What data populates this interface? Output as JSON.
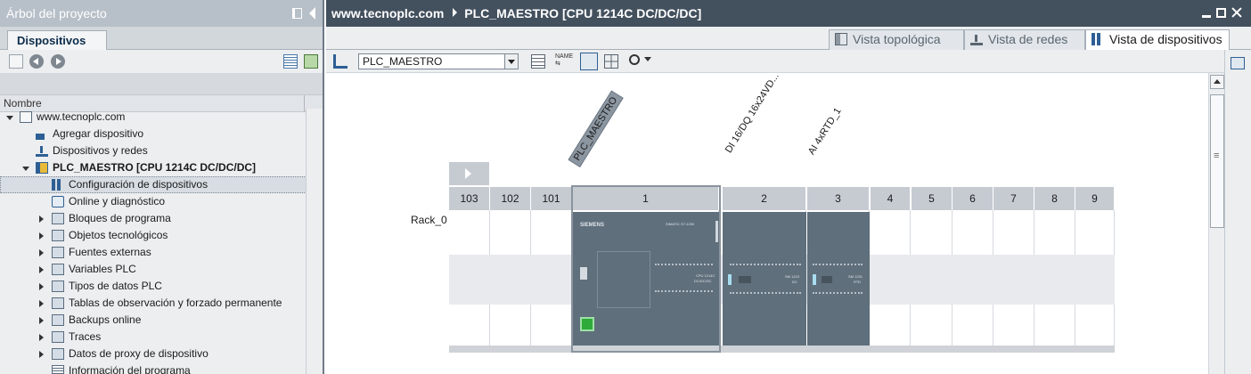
{
  "left": {
    "title": "Árbol del proyecto",
    "tab": "Dispositivos",
    "column_header": "Nombre",
    "tree": [
      {
        "label": "www.tecnoplc.com",
        "level": 0,
        "twisty": "open",
        "icon": "project-icon"
      },
      {
        "label": "Agregar dispositivo",
        "level": 1,
        "twisty": "none",
        "icon": "add-device-icon"
      },
      {
        "label": "Dispositivos y redes",
        "level": 1,
        "twisty": "none",
        "icon": "network-icon"
      },
      {
        "label": "PLC_MAESTRO [CPU 1214C DC/DC/DC]",
        "level": 1,
        "twisty": "open",
        "icon": "plc-icon",
        "bold": true
      },
      {
        "label": "Configuración de dispositivos",
        "level": 2,
        "twisty": "none",
        "icon": "device-config-icon",
        "selected": true
      },
      {
        "label": "Online y diagnóstico",
        "level": 2,
        "twisty": "none",
        "icon": "online-diagnostics-icon"
      },
      {
        "label": "Bloques de programa",
        "level": 2,
        "twisty": "closed",
        "icon": "folder-icon"
      },
      {
        "label": "Objetos tecnológicos",
        "level": 2,
        "twisty": "closed",
        "icon": "folder-icon"
      },
      {
        "label": "Fuentes externas",
        "level": 2,
        "twisty": "closed",
        "icon": "folder-icon"
      },
      {
        "label": "Variables PLC",
        "level": 2,
        "twisty": "closed",
        "icon": "folder-icon"
      },
      {
        "label": "Tipos de datos PLC",
        "level": 2,
        "twisty": "closed",
        "icon": "folder-icon"
      },
      {
        "label": "Tablas de observación y forzado permanente",
        "level": 2,
        "twisty": "closed",
        "icon": "folder-icon"
      },
      {
        "label": "Backups online",
        "level": 2,
        "twisty": "closed",
        "icon": "folder-icon"
      },
      {
        "label": "Traces",
        "level": 2,
        "twisty": "closed",
        "icon": "folder-icon"
      },
      {
        "label": "Datos de proxy de dispositivo",
        "level": 2,
        "twisty": "closed",
        "icon": "folder-icon"
      },
      {
        "label": "Información del programa",
        "level": 2,
        "twisty": "none",
        "icon": "program-info-icon"
      }
    ]
  },
  "right": {
    "breadcrumb_root": "www.tecnoplc.com",
    "breadcrumb_device": "PLC_MAESTRO [CPU 1214C DC/DC/DC]",
    "tabs": [
      {
        "label": "Vista topológica",
        "icon": "topology-icon",
        "active": false
      },
      {
        "label": "Vista de redes",
        "icon": "network-icon",
        "active": false
      },
      {
        "label": "Vista de dispositivos",
        "icon": "device-view-icon",
        "active": true
      }
    ],
    "device_select": "PLC_MAESTRO",
    "rack_label": "Rack_0",
    "slots": [
      "103",
      "102",
      "101",
      "1",
      "2",
      "3",
      "4",
      "5",
      "6",
      "7",
      "8",
      "9"
    ],
    "module_labels": [
      "PLC_MAESTRO",
      "DI 16/DQ 16x24VD...",
      "AI 4xRTD_1"
    ],
    "module_text": {
      "brand": "SIEMENS",
      "cpu_family": "SIMATIC S7-1200",
      "cpu_model": "CPU 1214C",
      "cpu_variant": "DC/DC/DC",
      "sm1_code": "SM 1223",
      "sm1_variant": "DC",
      "sm2_code": "SM 1231",
      "sm2_variant": "RTD"
    }
  },
  "colors": {
    "left_title_bg": "#b7bfc8",
    "right_title_bg": "#43505e",
    "module_bg": "#5f6f7c",
    "slot_header_bg": "#c6cbd2"
  }
}
